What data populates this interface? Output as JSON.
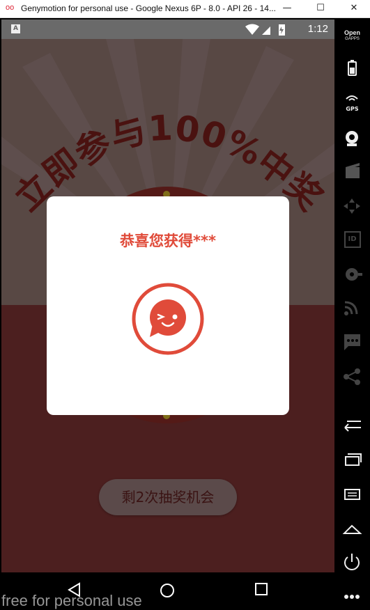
{
  "window": {
    "title": "Genymotion for personal use - Google Nexus 6P - 8.0 - API 26 - 14...",
    "minimize": "—",
    "maximize": "☐",
    "close": "✕"
  },
  "statusbar": {
    "time": "1:12",
    "notif_icon": "A"
  },
  "screen": {
    "headline": "立即参与100%中奖",
    "chance_button": "剩2次抽奖机会"
  },
  "dialog": {
    "title": "恭喜您获得***"
  },
  "watermark": "free for personal use",
  "side_panel": {
    "opengapps_line1": "Open",
    "opengapps_line2": "GAPPS",
    "gps_label": "GPS",
    "id_label": "ID",
    "icons": [
      "battery-icon",
      "gps-icon",
      "webcam-icon",
      "video-capture-icon",
      "dpad-icon",
      "identifiers-icon",
      "disk-io-icon",
      "network-icon",
      "sms-icon",
      "share-icon",
      "back-icon",
      "recent-apps-icon",
      "menu-icon",
      "home-icon",
      "power-icon",
      "more-icon"
    ]
  },
  "colors": {
    "accent": "#e04b3a",
    "background_upper": "#584844",
    "background_lower": "#4c1f1f"
  }
}
